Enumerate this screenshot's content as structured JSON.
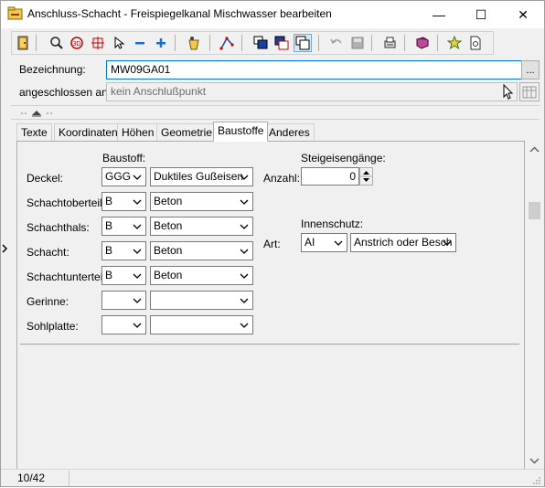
{
  "window": {
    "title": "Anschluss-Schacht - Freispiegelkanal Mischwasser bearbeiten",
    "minimize": "—",
    "maximize": "☐",
    "close": "✕"
  },
  "header": {
    "bezeichnung_label": "Bezeichnung:",
    "bezeichnung_value": "MW09GA01",
    "ellipsis": "...",
    "angeschlossen_label": "angeschlossen an:",
    "angeschlossen_placeholder": "kein Anschlußpunkt"
  },
  "tabs": [
    "Texte",
    "Koordinaten",
    "Höhen",
    "Geometrie",
    "Baustoffe",
    "Anderes"
  ],
  "active_tab": "Baustoffe",
  "baustoffe": {
    "heading": "Baustoff:",
    "rows": [
      {
        "label": "Deckel:",
        "code": "GGG",
        "material": "Duktiles Gußeisen"
      },
      {
        "label": "Schachtoberteil:",
        "code": "B",
        "material": "Beton"
      },
      {
        "label": "Schachthals:",
        "code": "B",
        "material": "Beton"
      },
      {
        "label": "Schacht:",
        "code": "B",
        "material": "Beton"
      },
      {
        "label": "Schachtunterteil:",
        "code": "B",
        "material": "Beton"
      },
      {
        "label": "Gerinne:",
        "code": "",
        "material": ""
      },
      {
        "label": "Sohlplatte:",
        "code": "",
        "material": ""
      }
    ]
  },
  "steigeisen": {
    "heading": "Steigeisengänge:",
    "anzahl_label": "Anzahl:",
    "anzahl_value": "0"
  },
  "innenschutz": {
    "heading": "Innenschutz:",
    "art_label": "Art:",
    "code": "AI",
    "material": "Anstrich oder Besch"
  },
  "status": {
    "record": "10/42"
  },
  "icons": {
    "app": "folder-pipe-icon",
    "toolbar": [
      "exit-door-icon",
      "zoom-icon",
      "zoom-extent-icon",
      "crosshair-icon",
      "pointer-icon",
      "minus-icon",
      "plus-icon",
      "bucket-icon",
      "edit-nodes-icon",
      "layer-front-icon",
      "layer-select-icon",
      "layer-copy-icon",
      "undo-icon",
      "save-icon",
      "print-preview-icon",
      "book-icon",
      "star-icon",
      "document-icon"
    ]
  },
  "colors": {
    "focus_border": "#0078d7",
    "tb_pressed": "#d9e8f6"
  }
}
